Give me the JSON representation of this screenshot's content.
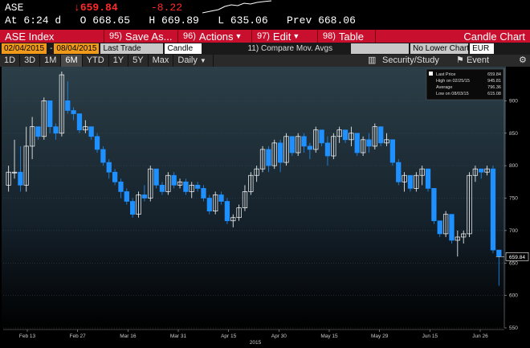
{
  "quote": {
    "symbol": "ASE",
    "last_arrow": "↓",
    "last": "659.84",
    "change": "-8.22",
    "row2": "At 6:24 d   O 668.65   H 669.89   L 635.06   Prev 668.06"
  },
  "menu": {
    "ticker": "ASE Index",
    "save_num": "95)",
    "save": "Save As...",
    "actions_num": "96)",
    "actions": "Actions",
    "edit_num": "97)",
    "edit": "Edit",
    "table_num": "98)",
    "table": "Table",
    "right_title": "Candle Chart",
    "brand_color": "#c8102e"
  },
  "inputs": {
    "start_date": "02/04/2015",
    "end_date": "08/04/2015",
    "price_field": "Last Trade",
    "chart_type": "Candle",
    "compare_num": "11)",
    "compare": "Compare",
    "compare_value": "Mov. Avgs",
    "lower_chart": "No Lower Chart",
    "currency": "EUR"
  },
  "periods": {
    "items": [
      "1D",
      "3D",
      "1M",
      "6M",
      "YTD",
      "1Y",
      "5Y",
      "Max"
    ],
    "active": "6M",
    "frequency": "Daily",
    "security_study": "Security/Study",
    "event": "Event"
  },
  "legend": {
    "last_price_label": "Last Price",
    "last_price": "659.84",
    "high_label": "High on 02/25/15",
    "high": "945.81",
    "avg_label": "Average",
    "avg": "796.36",
    "low_label": "Low on 08/03/15",
    "low": "615.08"
  },
  "chart_data": {
    "type": "candlestick",
    "ylim": [
      550,
      950
    ],
    "y_ticks": [
      550,
      600,
      650,
      700,
      750,
      800,
      850,
      900
    ],
    "x_tick_labels": [
      "Feb 13",
      "Feb 27",
      "Mar 16",
      "Mar 31",
      "Apr 15",
      "Apr 30",
      "May 15",
      "May 29",
      "Jun 15",
      "Jun 26"
    ],
    "x_year_label": "2015",
    "last_price_tag": "659.84",
    "up_color": "#ffffff",
    "down_color": "#1e90ff",
    "candles": [
      [
        770,
        800,
        760,
        790
      ],
      [
        790,
        840,
        780,
        790
      ],
      [
        790,
        830,
        760,
        770
      ],
      [
        770,
        860,
        760,
        830
      ],
      [
        830,
        875,
        810,
        860
      ],
      [
        860,
        850,
        840,
        845
      ],
      [
        845,
        905,
        840,
        900
      ],
      [
        900,
        875,
        850,
        860
      ],
      [
        860,
        865,
        840,
        850
      ],
      [
        850,
        945,
        845,
        940
      ],
      [
        900,
        930,
        880,
        885
      ],
      [
        885,
        890,
        870,
        880
      ],
      [
        880,
        870,
        850,
        855
      ],
      [
        855,
        870,
        850,
        860
      ],
      [
        860,
        855,
        840,
        845
      ],
      [
        845,
        850,
        820,
        825
      ],
      [
        825,
        830,
        800,
        805
      ],
      [
        805,
        810,
        780,
        790
      ],
      [
        790,
        795,
        770,
        775
      ],
      [
        775,
        780,
        750,
        760
      ],
      [
        760,
        765,
        740,
        745
      ],
      [
        745,
        750,
        720,
        725
      ],
      [
        725,
        760,
        720,
        755
      ],
      [
        755,
        770,
        745,
        750
      ],
      [
        750,
        800,
        745,
        795
      ],
      [
        795,
        790,
        765,
        770
      ],
      [
        770,
        775,
        755,
        760
      ],
      [
        760,
        790,
        755,
        785
      ],
      [
        785,
        790,
        765,
        770
      ],
      [
        770,
        780,
        765,
        775
      ],
      [
        775,
        780,
        755,
        760
      ],
      [
        760,
        775,
        750,
        770
      ],
      [
        770,
        775,
        760,
        765
      ],
      [
        765,
        770,
        745,
        750
      ],
      [
        750,
        755,
        725,
        730
      ],
      [
        730,
        760,
        725,
        755
      ],
      [
        755,
        760,
        740,
        745
      ],
      [
        745,
        750,
        710,
        715
      ],
      [
        715,
        725,
        705,
        720
      ],
      [
        720,
        740,
        715,
        735
      ],
      [
        735,
        770,
        730,
        760
      ],
      [
        760,
        790,
        755,
        785
      ],
      [
        785,
        800,
        775,
        795
      ],
      [
        795,
        830,
        790,
        825
      ],
      [
        825,
        830,
        790,
        800
      ],
      [
        800,
        840,
        795,
        835
      ],
      [
        835,
        840,
        790,
        805
      ],
      [
        805,
        850,
        800,
        845
      ],
      [
        845,
        840,
        815,
        820
      ],
      [
        820,
        850,
        815,
        845
      ],
      [
        845,
        850,
        820,
        830
      ],
      [
        830,
        835,
        810,
        825
      ],
      [
        825,
        860,
        820,
        855
      ],
      [
        855,
        855,
        830,
        835
      ],
      [
        835,
        845,
        800,
        815
      ],
      [
        815,
        850,
        810,
        845
      ],
      [
        845,
        860,
        835,
        855
      ],
      [
        855,
        855,
        835,
        840
      ],
      [
        840,
        860,
        830,
        850
      ],
      [
        850,
        840,
        815,
        820
      ],
      [
        820,
        845,
        815,
        840
      ],
      [
        840,
        850,
        820,
        830
      ],
      [
        830,
        865,
        825,
        860
      ],
      [
        860,
        850,
        830,
        835
      ],
      [
        835,
        850,
        830,
        840
      ],
      [
        840,
        820,
        800,
        805
      ],
      [
        805,
        810,
        770,
        775
      ],
      [
        775,
        790,
        760,
        785
      ],
      [
        785,
        780,
        760,
        765
      ],
      [
        765,
        790,
        760,
        785
      ],
      [
        785,
        800,
        770,
        795
      ],
      [
        795,
        780,
        760,
        765
      ],
      [
        765,
        760,
        710,
        715
      ],
      [
        715,
        700,
        690,
        695
      ],
      [
        695,
        730,
        690,
        725
      ],
      [
        725,
        700,
        680,
        685
      ],
      [
        685,
        700,
        660,
        690
      ],
      [
        690,
        700,
        680,
        695
      ],
      [
        695,
        790,
        690,
        785
      ],
      [
        785,
        800,
        775,
        795
      ],
      [
        795,
        795,
        780,
        790
      ],
      [
        790,
        800,
        785,
        795
      ],
      [
        795,
        800,
        665,
        670
      ],
      [
        670,
        665,
        615,
        660
      ]
    ]
  }
}
